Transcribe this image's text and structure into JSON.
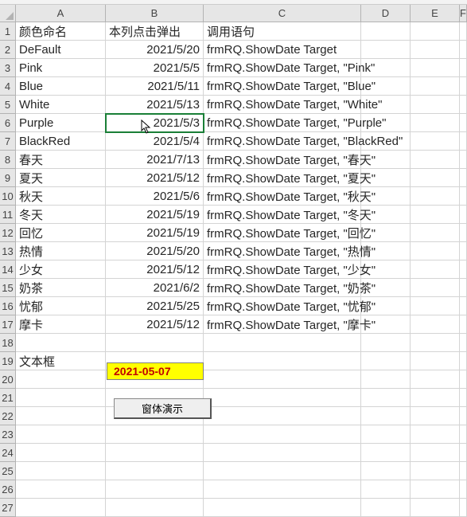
{
  "columns": [
    "A",
    "B",
    "C",
    "D",
    "E",
    "F"
  ],
  "row_count": 27,
  "headers": {
    "A": "颜色命名",
    "B": "本列点击弹出",
    "C": "调用语句"
  },
  "rows": [
    {
      "a": "DeFault",
      "b": "2021/5/20",
      "c": "frmRQ.ShowDate Target"
    },
    {
      "a": "Pink",
      "b": "2021/5/5",
      "c": "frmRQ.ShowDate Target, \"Pink\""
    },
    {
      "a": "Blue",
      "b": "2021/5/11",
      "c": "frmRQ.ShowDate Target, \"Blue\""
    },
    {
      "a": "White",
      "b": "2021/5/13",
      "c": "frmRQ.ShowDate Target, \"White\""
    },
    {
      "a": "Purple",
      "b": "2021/5/3",
      "c": "frmRQ.ShowDate Target, \"Purple\""
    },
    {
      "a": "BlackRed",
      "b": "2021/5/4",
      "c": "frmRQ.ShowDate Target, \"BlackRed\""
    },
    {
      "a": "春天",
      "b": "2021/7/13",
      "c": "frmRQ.ShowDate Target, \"春天\""
    },
    {
      "a": "夏天",
      "b": "2021/5/12",
      "c": "frmRQ.ShowDate Target, \"夏天\""
    },
    {
      "a": "秋天",
      "b": "2021/5/6",
      "c": "frmRQ.ShowDate Target, \"秋天\""
    },
    {
      "a": "冬天",
      "b": "2021/5/19",
      "c": "frmRQ.ShowDate Target, \"冬天\""
    },
    {
      "a": "回忆",
      "b": "2021/5/19",
      "c": "frmRQ.ShowDate Target, \"回忆\""
    },
    {
      "a": "热情",
      "b": "2021/5/20",
      "c": "frmRQ.ShowDate Target, \"热情\""
    },
    {
      "a": "少女",
      "b": "2021/5/12",
      "c": "frmRQ.ShowDate Target, \"少女\""
    },
    {
      "a": "奶茶",
      "b": "2021/6/2",
      "c": "frmRQ.ShowDate Target, \"奶茶\""
    },
    {
      "a": "忧郁",
      "b": "2021/5/25",
      "c": "frmRQ.ShowDate Target, \"忧郁\""
    },
    {
      "a": "摩卡",
      "b": "2021/5/12",
      "c": "frmRQ.ShowDate Target, \"摩卡\""
    }
  ],
  "row19_a": "文本框",
  "textbox_value": "2021-05-07",
  "button_label": "窗体演示",
  "selected_cell": "B6"
}
